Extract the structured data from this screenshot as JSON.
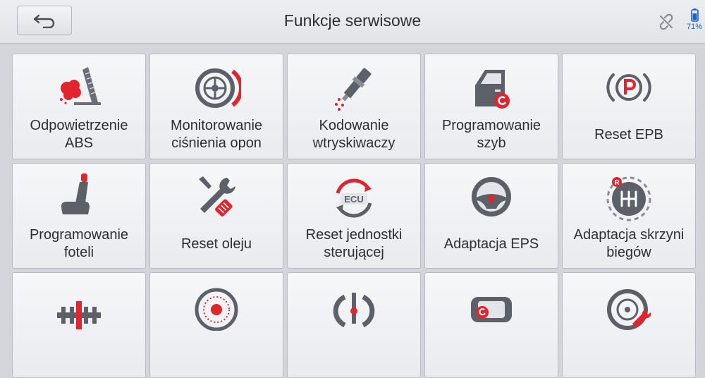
{
  "header": {
    "title": "Funkcje serwisowe",
    "back_icon": "back-arrow-icon",
    "link_icon": "link-broken-icon",
    "battery_icon": "battery-icon",
    "battery_level": "71%"
  },
  "colors": {
    "accent": "#e0252c",
    "icon_gray": "#5c6068",
    "battery_blue": "#1f62d6"
  },
  "tiles": [
    {
      "label": "Odpowietrzenie ABS",
      "icon": "abs-bleeding-icon"
    },
    {
      "label": "Monitorowanie ciśnienia opon",
      "icon": "tire-pressure-icon"
    },
    {
      "label": "Kodowanie wtryskiwaczy",
      "icon": "injector-icon"
    },
    {
      "label": "Programowanie szyb",
      "icon": "car-window-icon"
    },
    {
      "label": "Reset EPB",
      "icon": "parking-brake-icon"
    },
    {
      "label": "Programowanie foteli",
      "icon": "car-seat-icon"
    },
    {
      "label": "Reset oleju",
      "icon": "wrench-screwdriver-icon"
    },
    {
      "label": "Reset jednostki sterującej",
      "icon": "ecu-reset-icon"
    },
    {
      "label": "Adaptacja EPS",
      "icon": "steering-wheel-icon"
    },
    {
      "label": "Adaptacja skrzyni biegów",
      "icon": "gearbox-icon"
    },
    {
      "label": "",
      "icon": "camshaft-icon"
    },
    {
      "label": "",
      "icon": "brake-disc-icon"
    },
    {
      "label": "",
      "icon": "throttle-icon"
    },
    {
      "label": "",
      "icon": "car-reset-icon"
    },
    {
      "label": "",
      "icon": "wheel-repair-icon"
    }
  ]
}
